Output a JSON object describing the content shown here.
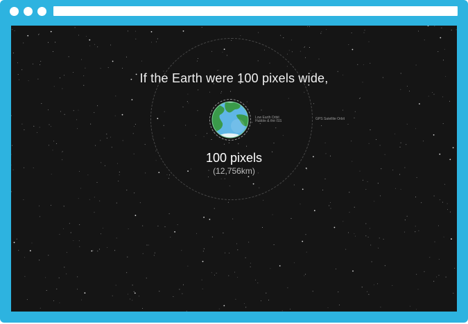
{
  "browser": {
    "url": ""
  },
  "page": {
    "headline": "If the Earth were 100 pixels wide,",
    "earth_size_label": "100 pixels",
    "earth_km_label": "(12,756km)",
    "orbits": {
      "leo_line1": "Low Earth Orbit",
      "leo_line2": "Hubble & the ISS",
      "gps": "GPS Satellite Orbit"
    }
  },
  "colors": {
    "frame": "#2db3e0",
    "space": "#151515",
    "ocean": "#5fb6e6",
    "land": "#3a9a4a"
  },
  "icons": {
    "earth": "earth-globe-icon"
  }
}
